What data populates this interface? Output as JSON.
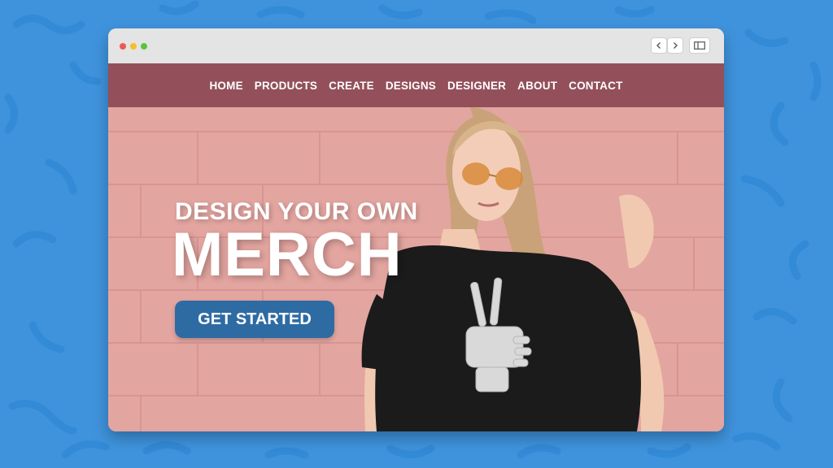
{
  "colors": {
    "background": "#3f93dc",
    "navbar": "#93505a",
    "cta": "#2e6ba3",
    "hero_wall": "#e3a5a0"
  },
  "browser": {
    "controls": [
      "close-dot",
      "minimize-dot",
      "maximize-dot"
    ],
    "buttons": [
      "back-arrow-icon",
      "forward-arrow-icon",
      "sidebar-icon"
    ]
  },
  "nav": {
    "items": [
      "HOME",
      "PRODUCTS",
      "CREATE",
      "DESIGNS",
      "DESIGNER",
      "ABOUT",
      "CONTACT"
    ]
  },
  "hero": {
    "headline_line1": "DESIGN YOUR OWN",
    "headline_line2": "MERCH",
    "cta_label": "GET STARTED"
  }
}
